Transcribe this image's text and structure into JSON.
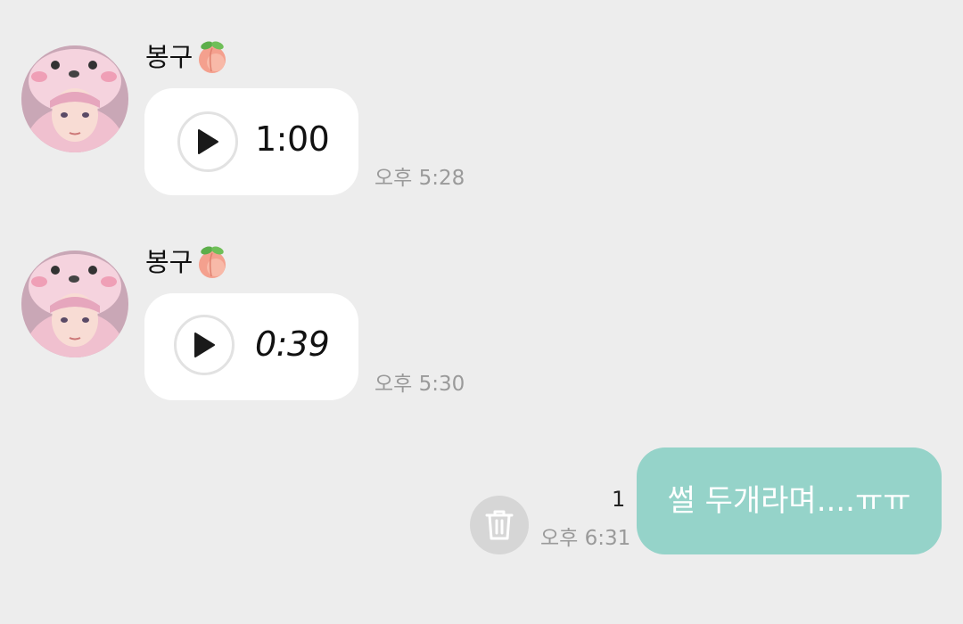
{
  "messages": [
    {
      "sender": "봉구",
      "sender_emoji": "peach-icon",
      "type": "voice",
      "duration": "1:00",
      "time": "오후 5:28"
    },
    {
      "sender": "봉구",
      "sender_emoji": "peach-icon",
      "type": "voice",
      "duration": "0:39",
      "time": "오후 5:30"
    }
  ],
  "sent_message": {
    "text": "썰 두개라며....ㅠㅠ",
    "unread_count": "1",
    "time": "오후 6:31",
    "action_icon": "trash-icon"
  },
  "colors": {
    "background": "#ededed",
    "received_bubble": "#ffffff",
    "sent_bubble": "#95d3c9",
    "timestamp": "#9a9a9a"
  }
}
